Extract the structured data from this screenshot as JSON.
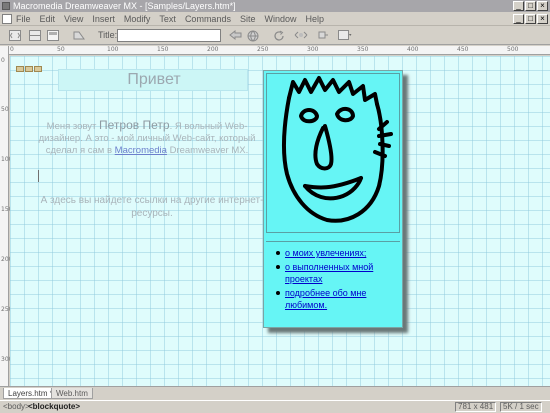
{
  "window": {
    "title": "Macromedia Dreamweaver MX - [Samples/Layers.htm*]",
    "controls": {
      "minimize": "_",
      "maximize": "□",
      "close": "×"
    }
  },
  "menu": {
    "items": [
      "File",
      "Edit",
      "View",
      "Insert",
      "Modify",
      "Text",
      "Commands",
      "Site",
      "Window",
      "Help"
    ]
  },
  "toolbar": {
    "title_label": "Title:",
    "title_value": ""
  },
  "rulers": {
    "top": [
      "0",
      "50",
      "100",
      "150",
      "200",
      "250",
      "300",
      "350",
      "400",
      "450",
      "500"
    ],
    "left": [
      "0",
      "50",
      "100",
      "150",
      "200",
      "250",
      "300"
    ]
  },
  "document": {
    "heading": "Привет",
    "intro_prefix": "Меня зовут ",
    "intro_name": "Петров Петр",
    "intro_middle": ". Я вольный Web-дизайнер. А это - мой личный Web-сайт, который сделал я сам в ",
    "intro_link": "Macromedia",
    "intro_suffix": " Dreamweaver MX.",
    "links_note": "А здесь вы найдете ссылки на другие интернет-ресурсы.",
    "right_layer": {
      "links": [
        "о моих увлечениях;",
        "о выполненных мной проектах",
        "подробнее обо мне любимом."
      ]
    }
  },
  "tabs": [
    "Layers.htm *",
    "Web.htm"
  ],
  "active_tab": 0,
  "status": {
    "tag_body": "<body>",
    "tag_blockquote": "<blockquote>",
    "window_size": "781 x 481",
    "download": "5K / 1 sec"
  },
  "colors": {
    "canvas_bg": "#dffcfc",
    "layer_bg": "#66f5f5",
    "link": "#0000cc"
  }
}
